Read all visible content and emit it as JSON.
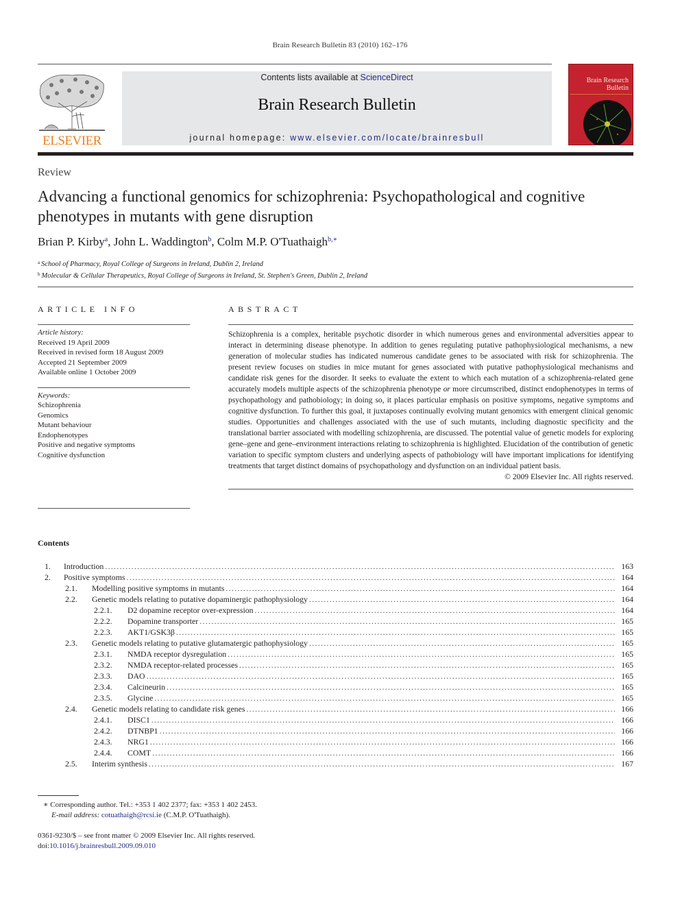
{
  "running_head": "Brain Research Bulletin 83 (2010) 162–176",
  "masthead": {
    "publisher_logo_text": "ELSEVIER",
    "contents_prefix": "Contents lists available at ",
    "contents_link": "ScienceDirect",
    "journal_title": "Brain Research Bulletin",
    "homepage_prefix": "journal homepage: ",
    "homepage_link": "www.elsevier.com/locate/brainresbull",
    "cover_title_line1": "Brain Research",
    "cover_title_line2": "Bulletin",
    "colors": {
      "link": "#1f2c84",
      "elsevier_orange": "#f07f1b",
      "cover_red": "#c4222f",
      "masthead_bg": "#e6e7e8"
    }
  },
  "article": {
    "type": "Review",
    "title": "Advancing a functional genomics for schizophrenia: Psychopathological and cognitive phenotypes in mutants with gene disruption",
    "authors": [
      {
        "name": "Brian P. Kirby",
        "marks": "a"
      },
      {
        "name": "John L. Waddington",
        "marks": "b"
      },
      {
        "name": "Colm M.P. O'Tuathaigh",
        "marks": "b,∗"
      }
    ],
    "affiliations": [
      {
        "mark": "a",
        "text": "School of Pharmacy, Royal College of Surgeons in Ireland, Dublin 2, Ireland"
      },
      {
        "mark": "b",
        "text": "Molecular & Cellular Therapeutics, Royal College of Surgeons in Ireland, St. Stephen's Green, Dublin 2, Ireland"
      }
    ]
  },
  "article_info": {
    "heading": "ARTICLE INFO",
    "history_label": "Article history:",
    "history": [
      "Received 19 April 2009",
      "Received in revised form 18 August 2009",
      "Accepted 21 September 2009",
      "Available online 1 October 2009"
    ],
    "keywords_label": "Keywords:",
    "keywords": [
      "Schizophrenia",
      "Genomics",
      "Mutant behaviour",
      "Endophenotypes",
      "Positive and negative symptoms",
      "Cognitive dysfunction"
    ]
  },
  "abstract": {
    "heading": "ABSTRACT",
    "text_before_italic": "Schizophrenia is a complex, heritable psychotic disorder in which numerous genes and environmental adversities appear to interact in determining disease phenotype. In addition to genes regulating putative pathophysiological mechanisms, a new generation of molecular studies has indicated numerous candidate genes to be associated with risk for schizophrenia. The present review focuses on studies in mice mutant for genes associated with putative pathophysiological mechanisms and candidate risk genes for the disorder. It seeks to evaluate the extent to which each mutation of a schizophrenia-related gene accurately models multiple aspects of the schizophrenia phenotype ",
    "italic_word": "or",
    "text_after_italic": " more circumscribed, distinct endophenotypes in terms of psychopathology and pathobiology; in doing so, it places particular emphasis on positive symptoms, negative symptoms and cognitive dysfunction. To further this goal, it juxtaposes continually evolving mutant genomics with emergent clinical genomic studies. Opportunities and challenges associated with the use of such mutants, including diagnostic specificity and the translational barrier associated with modelling schizophrenia, are discussed. The potential value of genetic models for exploring gene–gene and gene–environment interactions relating to schizophrenia is highlighted. Elucidation of the contribution of genetic variation to specific symptom clusters and underlying aspects of pathobiology will have important implications for identifying treatments that target distinct domains of psychopathology and dysfunction on an individual patient basis.",
    "copyright": "© 2009 Elsevier Inc. All rights reserved."
  },
  "contents": {
    "heading": "Contents",
    "entries": [
      {
        "level": 1,
        "num": "1.",
        "title": "Introduction",
        "page": "163"
      },
      {
        "level": 1,
        "num": "2.",
        "title": "Positive symptoms",
        "page": "164"
      },
      {
        "level": 2,
        "num": "2.1.",
        "title": "Modelling positive symptoms in mutants",
        "page": "164"
      },
      {
        "level": 2,
        "num": "2.2.",
        "title": "Genetic models relating to putative dopaminergic pathophysiology",
        "page": "164"
      },
      {
        "level": 3,
        "num": "2.2.1.",
        "title": "D2 dopamine receptor over-expression",
        "page": "164"
      },
      {
        "level": 3,
        "num": "2.2.2.",
        "title": "Dopamine transporter",
        "page": "165"
      },
      {
        "level": 3,
        "num": "2.2.3.",
        "title": "AKT1/GSK3β",
        "page": "165"
      },
      {
        "level": 2,
        "num": "2.3.",
        "title": "Genetic models relating to putative glutamatergic pathophysiology",
        "page": "165"
      },
      {
        "level": 3,
        "num": "2.3.1.",
        "title": "NMDA receptor dysregulation",
        "page": "165"
      },
      {
        "level": 3,
        "num": "2.3.2.",
        "title": "NMDA receptor-related processes",
        "page": "165"
      },
      {
        "level": 3,
        "num": "2.3.3.",
        "title": "DAO",
        "page": "165"
      },
      {
        "level": 3,
        "num": "2.3.4.",
        "title": "Calcineurin",
        "page": "165"
      },
      {
        "level": 3,
        "num": "2.3.5.",
        "title": "Glycine",
        "page": "165"
      },
      {
        "level": 2,
        "num": "2.4.",
        "title": "Genetic models relating to candidate risk genes",
        "page": "166"
      },
      {
        "level": 3,
        "num": "2.4.1.",
        "title": "DISC1",
        "page": "166"
      },
      {
        "level": 3,
        "num": "2.4.2.",
        "title": "DTNBP1",
        "page": "166"
      },
      {
        "level": 3,
        "num": "2.4.3.",
        "title": "NRG1",
        "page": "166"
      },
      {
        "level": 3,
        "num": "2.4.4.",
        "title": "COMT",
        "page": "166"
      },
      {
        "level": 2,
        "num": "2.5.",
        "title": "Interim synthesis",
        "page": "167"
      }
    ]
  },
  "footnotes": {
    "corresponding": "∗  Corresponding author. Tel.: +353 1 402 2377; fax: +353 1 402 2453.",
    "email_label": "E-mail address: ",
    "email": "cotuathaigh@rcsi.ie",
    "email_suffix": " (C.M.P. O'Tuathaigh).",
    "front_matter": "0361-9230/$ – see front matter © 2009 Elsevier Inc. All rights reserved.",
    "doi_prefix": "doi:",
    "doi": "10.1016/j.brainresbull.2009.09.010"
  }
}
